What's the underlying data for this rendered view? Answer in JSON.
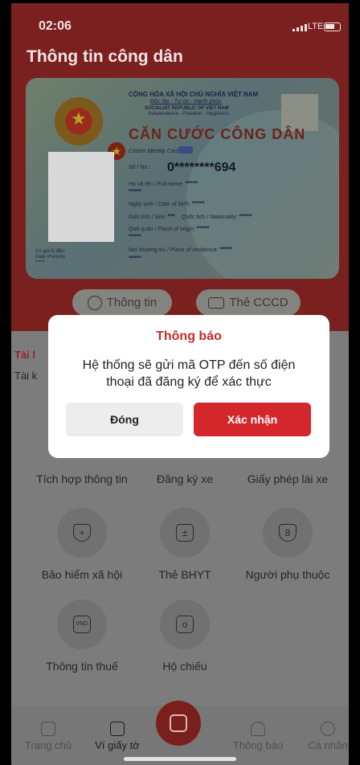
{
  "status": {
    "time": "02:06",
    "network": "LTE"
  },
  "page": {
    "title": "Thông tin công dân"
  },
  "card": {
    "header1": "CỘNG HÒA XÃ HỘI CHỦ NGHĨA VIỆT NAM",
    "header2": "Độc lập - Tự do - Hạnh phúc",
    "header3": "SOCIALIST REPUBLIC OF VIET NAM",
    "header4": "Independence - Freedom - Happiness",
    "title": "CĂN CƯỚC CÔNG DÂN",
    "subtitle": "Citizen Identity Card",
    "id_label": "Số / No.:",
    "id_value": "0********694",
    "name_label": "Họ và tên / Full name:",
    "name_value": "*****",
    "name_value2": "*****",
    "dob_label": "Ngày sinh / Date of birth:",
    "dob_value": "*****",
    "sex_label": "Giới tính / Sex:",
    "sex_value": "***",
    "nat_label": "Quốc tịch / Nationality:",
    "nat_value": "*****",
    "origin_label": "Quê quán / Place of origin:",
    "origin_value": "*****",
    "origin_value2": "*****",
    "res_label": "Nơi thường trú / Place of residence:",
    "res_value": "*****",
    "res_value2": "*****",
    "expiry_label": "Có giá trị đến:",
    "expiry_label_en": "Date of expiry",
    "expiry_value": "*****"
  },
  "tabs": {
    "info": "Thông tin",
    "card": "Thẻ CCCD"
  },
  "section": {
    "title": "Tài l",
    "subtitle": "Tài k"
  },
  "services": [
    {
      "label": "Tích hợp thông tin"
    },
    {
      "label": "Đăng ký xe"
    },
    {
      "label": "Giấy phép lái xe"
    },
    {
      "label": "Bảo hiểm xã hội",
      "icon": "+"
    },
    {
      "label": "Thẻ BHYT",
      "icon": "±"
    },
    {
      "label": "Người phụ thuộc",
      "icon": "8"
    },
    {
      "label": "Thông tin thuế",
      "icon": "VND"
    },
    {
      "label": "Hộ chiếu",
      "icon": "o"
    }
  ],
  "nav": {
    "home": "Trang chủ",
    "wallet": "Ví giấy tờ",
    "notify": "Thông báo",
    "profile": "Cá nhân"
  },
  "dialog": {
    "title": "Thông báo",
    "message": "Hệ thống sẽ gửi mã OTP đến số điện thoại đã đăng ký để xác thực",
    "cancel": "Đóng",
    "confirm": "Xác nhận"
  }
}
